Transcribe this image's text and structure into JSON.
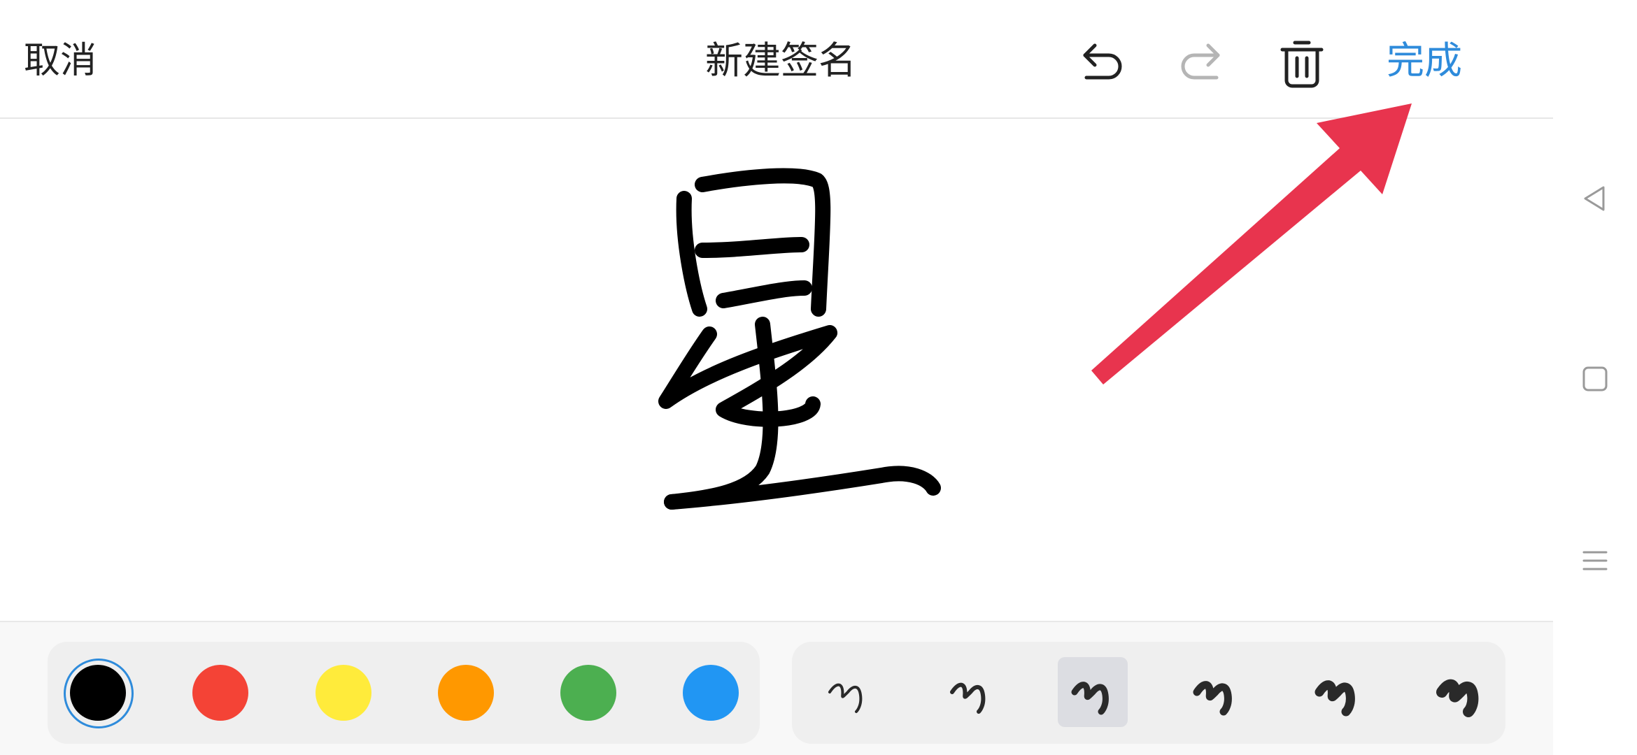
{
  "header": {
    "cancel_label": "取消",
    "title": "新建签名",
    "done_label": "完成"
  },
  "icons": {
    "undo": "undo-icon",
    "redo": "redo-icon",
    "delete": "trash-icon"
  },
  "colors": {
    "accent": "#2e8bdb",
    "annotation_arrow": "#e8344e",
    "palette": [
      "#000000",
      "#f44336",
      "#ffeb3b",
      "#ff9800",
      "#4caf50",
      "#2196f3"
    ],
    "selected_palette_index": 0
  },
  "brushes": {
    "count": 6,
    "selected_index": 2
  },
  "signature_text": "星"
}
